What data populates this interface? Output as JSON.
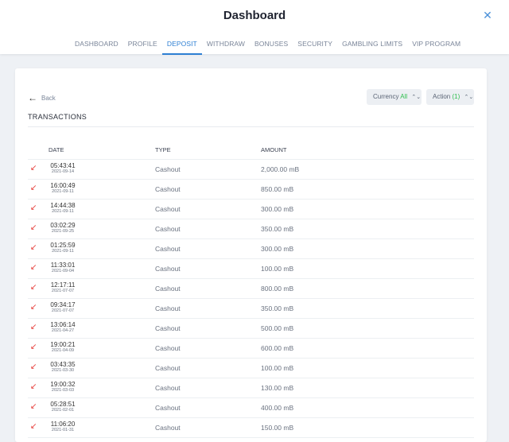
{
  "header": {
    "title": "Dashboard",
    "close_icon": "close-icon"
  },
  "tabs": [
    {
      "label": "DASHBOARD",
      "active": false
    },
    {
      "label": "PROFILE",
      "active": false
    },
    {
      "label": "DEPOSIT",
      "active": true
    },
    {
      "label": "WITHDRAW",
      "active": false
    },
    {
      "label": "BONUSES",
      "active": false
    },
    {
      "label": "SECURITY",
      "active": false
    },
    {
      "label": "GAMBLING LIMITS",
      "active": false
    },
    {
      "label": "VIP PROGRAM",
      "active": false
    }
  ],
  "toolbar": {
    "back_label": "Back",
    "currency_label": "Currency",
    "currency_value": "All",
    "action_label": "Action",
    "action_value": "(1)"
  },
  "section_title": "TRANSACTIONS",
  "table": {
    "columns": [
      "DATE",
      "TYPE",
      "AMOUNT"
    ],
    "rows": [
      {
        "time": "05:43:41",
        "date": "2021-09-14",
        "type": "Cashout",
        "amount": "2,000.00 mB"
      },
      {
        "time": "16:00:49",
        "date": "2021-09-11",
        "type": "Cashout",
        "amount": "850.00 mB"
      },
      {
        "time": "14:44:38",
        "date": "2021-09-11",
        "type": "Cashout",
        "amount": "300.00 mB"
      },
      {
        "time": "03:02:29",
        "date": "2021-09-25",
        "type": "Cashout",
        "amount": "350.00 mB"
      },
      {
        "time": "01:25:59",
        "date": "2021-09-11",
        "type": "Cashout",
        "amount": "300.00 mB"
      },
      {
        "time": "11:33:01",
        "date": "2021-09-04",
        "type": "Cashout",
        "amount": "100.00 mB"
      },
      {
        "time": "12:17:11",
        "date": "2021-07-07",
        "type": "Cashout",
        "amount": "800.00 mB"
      },
      {
        "time": "09:34:17",
        "date": "2021-07-07",
        "type": "Cashout",
        "amount": "350.00 mB"
      },
      {
        "time": "13:06:14",
        "date": "2021-04-27",
        "type": "Cashout",
        "amount": "500.00 mB"
      },
      {
        "time": "19:00:21",
        "date": "2021-04-09",
        "type": "Cashout",
        "amount": "600.00 mB"
      },
      {
        "time": "03:43:35",
        "date": "2021-03-30",
        "type": "Cashout",
        "amount": "100.00 mB"
      },
      {
        "time": "19:00:32",
        "date": "2021-03-03",
        "type": "Cashout",
        "amount": "130.00 mB"
      },
      {
        "time": "05:28:51",
        "date": "2021-02-01",
        "type": "Cashout",
        "amount": "400.00 mB"
      },
      {
        "time": "11:06:20",
        "date": "2021-01-31",
        "type": "Cashout",
        "amount": "150.00 mB"
      }
    ],
    "row_icon": "outgoing-arrow-icon"
  },
  "colors": {
    "accent": "#2d7fd3",
    "currency_highlight": "#2fbf4e",
    "cashout_icon": "#e53935"
  }
}
